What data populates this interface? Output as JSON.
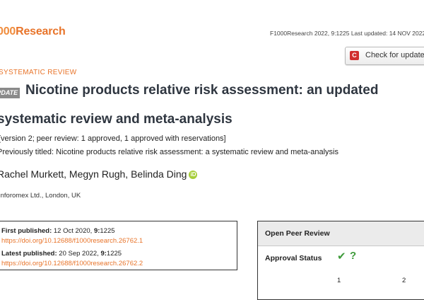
{
  "header": {
    "logo_prefix": "000",
    "logo_word": "Research",
    "meta": "F1000Research 2022, 9:1225 Last updated: 14 NOV 2022"
  },
  "check_button": {
    "badge": "C",
    "label": "Check for updates"
  },
  "article_type": "SYSTEMATIC REVIEW",
  "update_tag": "UPDATE",
  "title": {
    "line1": "Nicotine products relative risk assessment: an updated",
    "line2": "systematic review and meta-analysis"
  },
  "version": "[version 2; peer review: 1 approved, 1 approved with reservations]",
  "previous_title": "Previously titled: Nicotine products relative risk assessment: a systematic review and meta-analysis",
  "authors": "Rachel Murkett, Megyn Rugh, Belinda Ding",
  "orcid_label": "iD",
  "affiliation": "Inforomex Ltd., London, UK",
  "publication": {
    "first_label": "First published:",
    "first_date": "12 Oct 2020,",
    "first_vol": "9:",
    "first_id": "1225",
    "first_doi": "https://doi.org/10.12688/f1000research.26762.1",
    "latest_label": "Latest published:",
    "latest_date": "20 Sep 2022,",
    "latest_vol": "9:",
    "latest_id": "1225",
    "latest_doi": "https://doi.org/10.12688/f1000research.26762.2"
  },
  "peer_review": {
    "heading": "Open Peer Review",
    "approval_label": "Approval Status",
    "status_icons": [
      "check-icon",
      "question-icon"
    ],
    "reviewer_columns": [
      "1",
      "2"
    ]
  },
  "colors": {
    "accent": "#e8742a",
    "approved": "#3e9b3a",
    "title": "#2f3640"
  }
}
